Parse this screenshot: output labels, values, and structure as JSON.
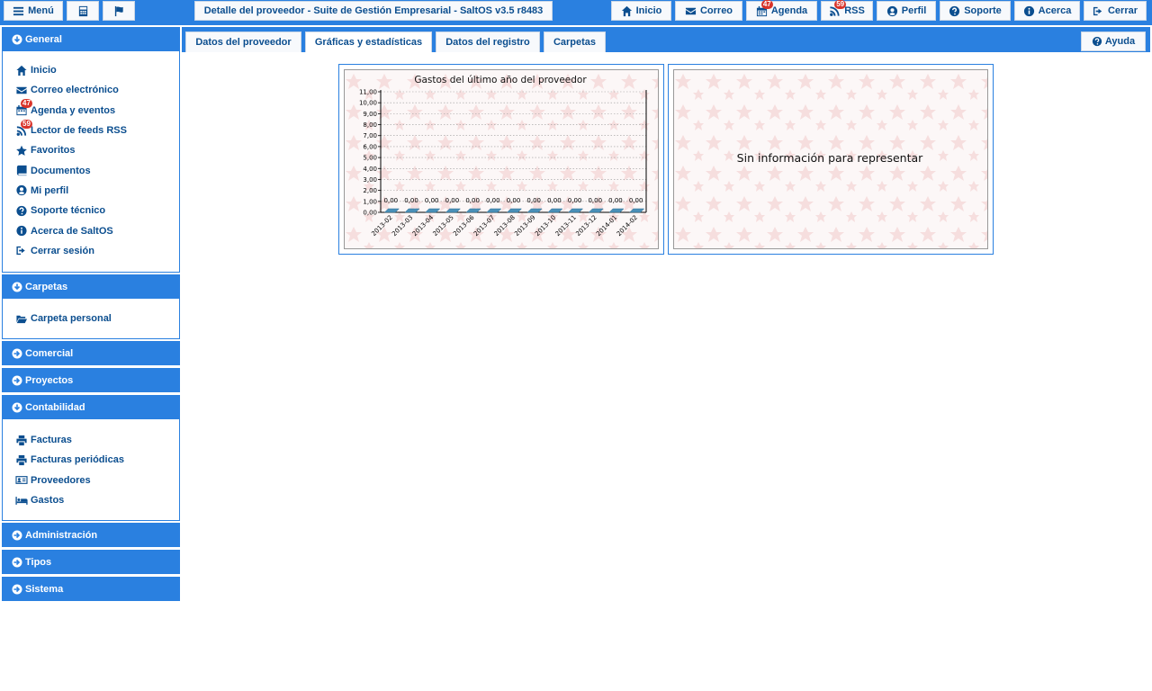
{
  "topbar": {
    "menu_label": "Menú",
    "calculator_icon": "calculator-icon",
    "flag_icon": "flag-icon",
    "window_title": "Detalle del proveedor - Suite de Gestión Empresarial - SaltOS v3.5 r8483",
    "buttons": {
      "inicio": "Inicio",
      "correo": "Correo",
      "agenda": "Agenda",
      "agenda_badge": "47",
      "rss": "RSS",
      "rss_badge": "59",
      "perfil": "Perfil",
      "soporte": "Soporte",
      "acerca": "Acerca",
      "cerrar": "Cerrar"
    }
  },
  "sidebar": {
    "general": {
      "title": "General",
      "items": [
        {
          "label": "Inicio",
          "icon": "home-icon"
        },
        {
          "label": "Correo electrónico",
          "icon": "envelope-icon"
        },
        {
          "label": "Agenda y eventos",
          "icon": "calendar-icon",
          "badge": "47"
        },
        {
          "label": "Lector de feeds RSS",
          "icon": "rss-icon",
          "badge": "59"
        },
        {
          "label": "Favoritos",
          "icon": "star-icon"
        },
        {
          "label": "Documentos",
          "icon": "book-icon"
        },
        {
          "label": "Mi perfil",
          "icon": "user-circle-icon"
        },
        {
          "label": "Soporte técnico",
          "icon": "question-circle-icon"
        },
        {
          "label": "Acerca de SaltOS",
          "icon": "info-circle-icon"
        },
        {
          "label": "Cerrar sesión",
          "icon": "sign-out-icon"
        }
      ]
    },
    "carpetas": {
      "title": "Carpetas",
      "items": [
        {
          "label": "Carpeta personal",
          "icon": "folder-open-icon"
        }
      ]
    },
    "comercial": {
      "title": "Comercial"
    },
    "proyectos": {
      "title": "Proyectos"
    },
    "contabilidad": {
      "title": "Contabilidad",
      "items": [
        {
          "label": "Facturas",
          "icon": "print-icon"
        },
        {
          "label": "Facturas periódicas",
          "icon": "print-icon"
        },
        {
          "label": "Proveedores",
          "icon": "address-card-icon"
        },
        {
          "label": "Gastos",
          "icon": "bed-icon"
        }
      ]
    },
    "administracion": {
      "title": "Administración"
    },
    "tipos": {
      "title": "Tipos"
    },
    "sistema": {
      "title": "Sistema"
    }
  },
  "tabs": [
    {
      "label": "Datos del proveedor"
    },
    {
      "label": "Gráficas y estadísticas",
      "active": true
    },
    {
      "label": "Datos del registro"
    },
    {
      "label": "Carpetas"
    }
  ],
  "help_label": "Ayuda",
  "charts": {
    "empty_message": "Sin información para representar"
  },
  "chart_data": {
    "type": "bar",
    "title": "Gastos del último año del proveedor",
    "categories": [
      "2013-02",
      "2013-03",
      "2013-04",
      "2013-05",
      "2013-06",
      "2013-07",
      "2013-08",
      "2013-09",
      "2013-10",
      "2013-11",
      "2013-12",
      "2014-01",
      "2014-02"
    ],
    "values": [
      0,
      0,
      0,
      0,
      0,
      0,
      0,
      0,
      0,
      0,
      0,
      0,
      0
    ],
    "value_labels": [
      "0,00",
      "0,00",
      "0,00",
      "0,00",
      "0,00",
      "0,00",
      "0,00",
      "0,00",
      "0,00",
      "0,00",
      "0,00",
      "0,00",
      "0,00"
    ],
    "ytick_labels": [
      "0,00",
      "1,00",
      "2,00",
      "3,00",
      "4,00",
      "5,00",
      "6,00",
      "7,00",
      "8,00",
      "9,00",
      "10,00",
      "11,00"
    ],
    "ylim": [
      0,
      11
    ],
    "xlabel": "",
    "ylabel": "",
    "grid": true,
    "bar_color": "#4a90b8"
  }
}
